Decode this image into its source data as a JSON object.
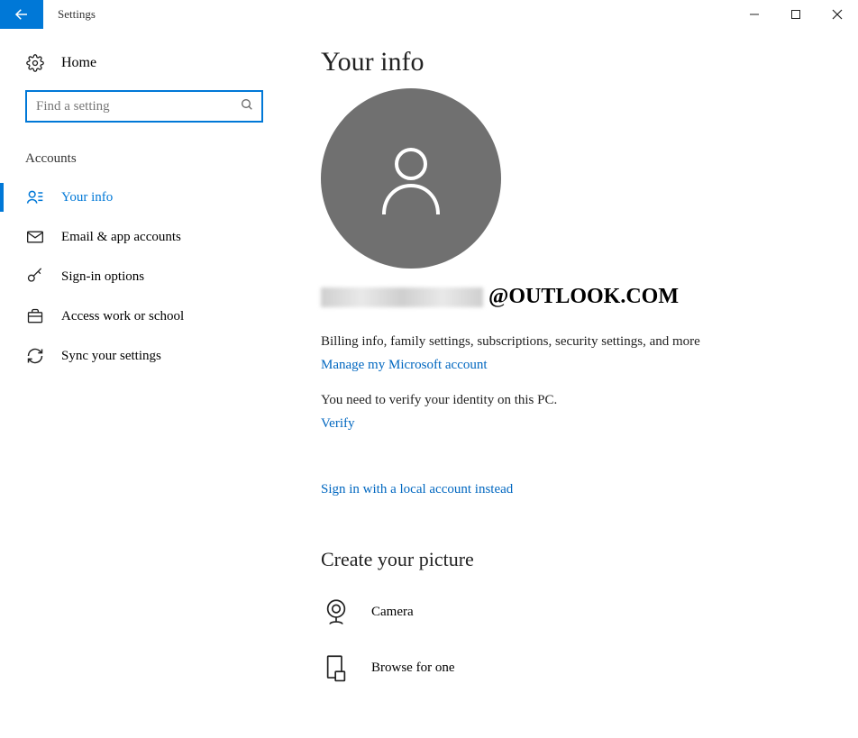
{
  "window": {
    "title": "Settings"
  },
  "sidebar": {
    "home_label": "Home",
    "search_placeholder": "Find a setting",
    "category_label": "Accounts",
    "items": [
      {
        "label": "Your info"
      },
      {
        "label": "Email & app accounts"
      },
      {
        "label": "Sign-in options"
      },
      {
        "label": "Access work or school"
      },
      {
        "label": "Sync your settings"
      }
    ]
  },
  "main": {
    "page_title": "Your info",
    "email_suffix": "@OUTLOOK.COM",
    "billing_desc": "Billing info, family settings, subscriptions, security settings, and more",
    "manage_link": "Manage my Microsoft account",
    "verify_desc": "You need to verify your identity on this PC.",
    "verify_link": "Verify",
    "local_signin_link": "Sign in with a local account instead",
    "picture_section_title": "Create your picture",
    "picture_options": [
      {
        "label": "Camera"
      },
      {
        "label": "Browse for one"
      }
    ]
  }
}
